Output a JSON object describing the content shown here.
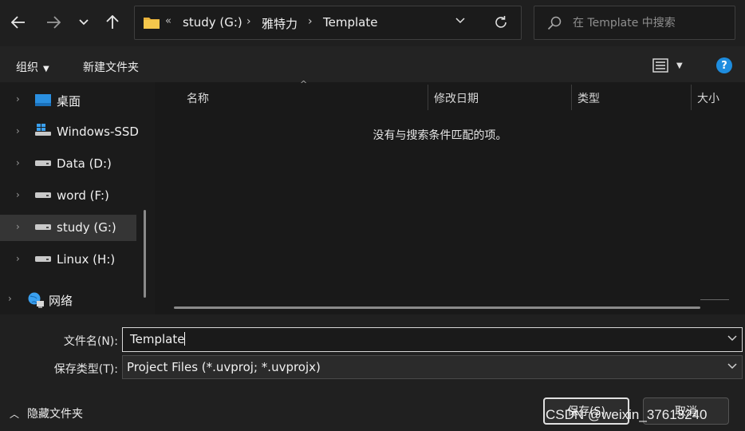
{
  "nav": {
    "back_icon": "back-arrow-icon",
    "forward_icon": "forward-arrow-icon",
    "recent_icon": "chevron-down-icon",
    "up_icon": "up-arrow-icon"
  },
  "address": {
    "overflow": "«",
    "crumbs": [
      "study (G:)",
      "雅特力",
      "Template"
    ],
    "separator": "›"
  },
  "search": {
    "placeholder": "在 Template 中搜索"
  },
  "command_bar": {
    "organize": "组织",
    "new_folder": "新建文件夹",
    "help": "?"
  },
  "sidebar": {
    "items": [
      {
        "label": "桌面",
        "icon": "desktop-icon"
      },
      {
        "label": "Windows-SSD",
        "icon": "windows-drive-icon"
      },
      {
        "label": "Data (D:)",
        "icon": "drive-icon"
      },
      {
        "label": "word (F:)",
        "icon": "drive-icon"
      },
      {
        "label": "study (G:)",
        "icon": "drive-icon",
        "selected": true
      },
      {
        "label": "Linux (H:)",
        "icon": "drive-icon"
      },
      {
        "label": "网络",
        "icon": "network-icon"
      }
    ]
  },
  "file_list": {
    "columns": [
      "名称",
      "修改日期",
      "类型",
      "大小"
    ],
    "sort_indicator": "^",
    "empty_message": "没有与搜索条件匹配的项。"
  },
  "bottom": {
    "filename_label": "文件名(N):",
    "filename_value": "Template",
    "filetype_label": "保存类型(T):",
    "filetype_value": "Project Files (*.uvproj; *.uvprojx)",
    "hide_folders": "隐藏文件夹",
    "save": "保存(S)",
    "cancel": "取消"
  },
  "watermark": "CSDN @weixin_37613240",
  "colors": {
    "background": "#191919",
    "accent": "#1e8ddf",
    "folder": "#e8b13a"
  }
}
